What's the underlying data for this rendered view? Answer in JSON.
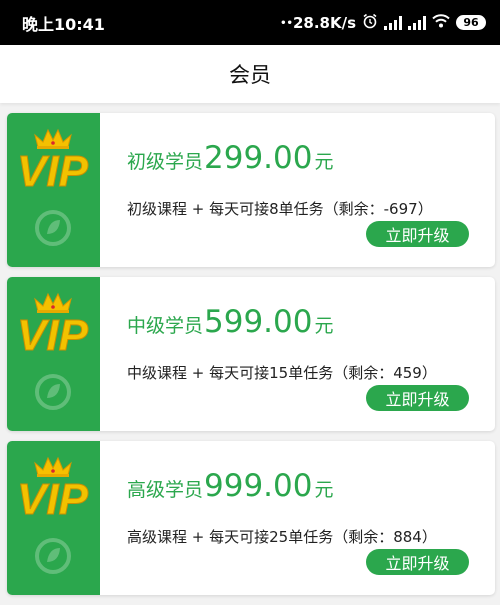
{
  "status_bar": {
    "time": "晚上10:41",
    "network_speed": "28.8K/s",
    "battery": "96"
  },
  "header": {
    "title": "会员"
  },
  "colors": {
    "accent": "#2ba74d",
    "crown": "#f5c000",
    "logo_text": "#f2c200"
  },
  "badge": {
    "logo_text": "VIP"
  },
  "icons": {
    "badge": "vip-crown-icon",
    "watermark": "sync-leaf-icon",
    "alarm": "alarm-clock-icon",
    "wifi": "wifi-icon",
    "signal": "signal-icon"
  },
  "cards": [
    {
      "level": "初级学员",
      "price": "299.00",
      "unit": "元",
      "description": "初级课程 + 每天可接8单任务（剩余：-697）",
      "button": "立即升级"
    },
    {
      "level": "中级学员",
      "price": "599.00",
      "unit": "元",
      "description": "中级课程 + 每天可接15单任务（剩余：459）",
      "button": "立即升级"
    },
    {
      "level": "高级学员",
      "price": "999.00",
      "unit": "元",
      "description": "高级课程 + 每天可接25单任务（剩余：884）",
      "button": "立即升级"
    }
  ]
}
